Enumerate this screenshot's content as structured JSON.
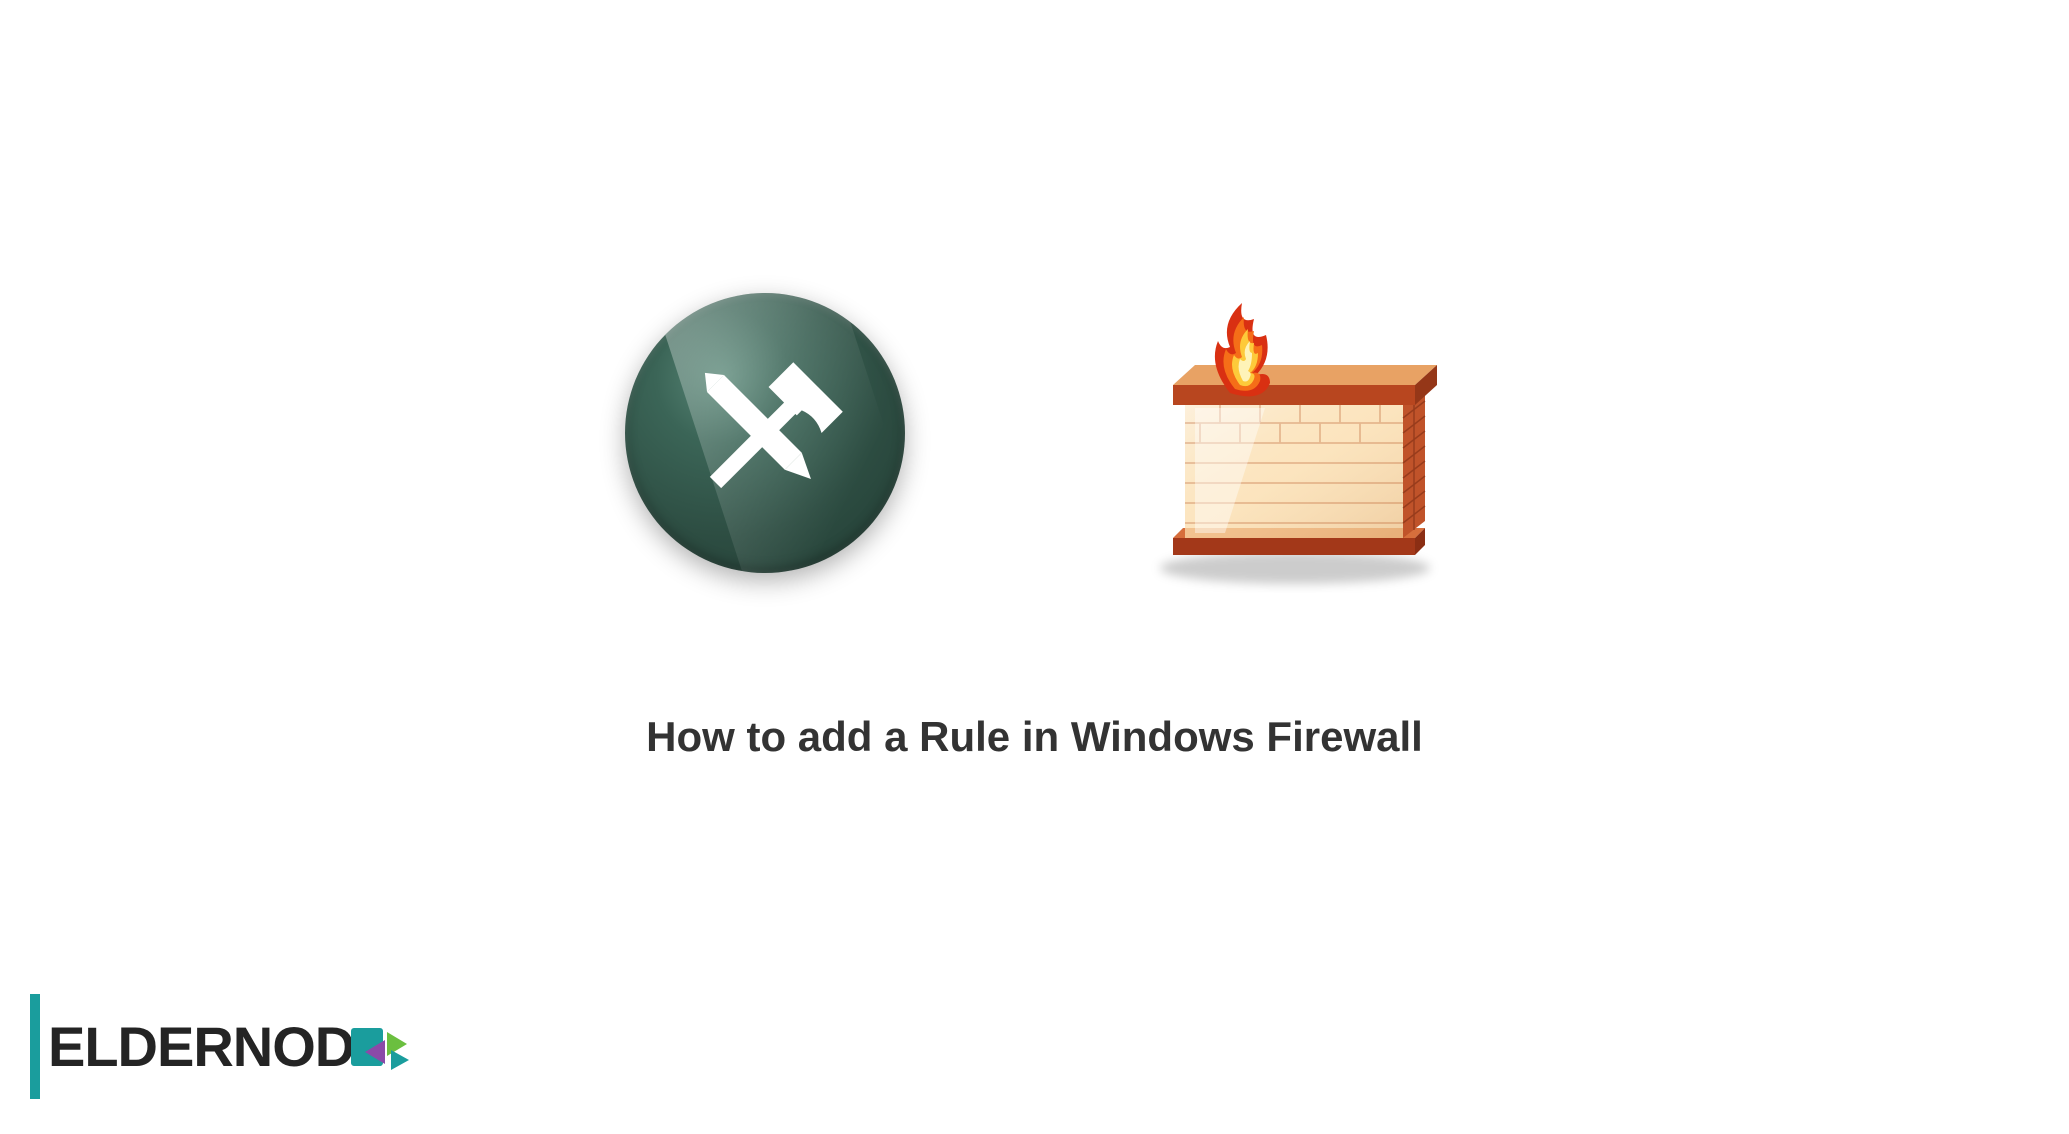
{
  "title": "How to add a Rule in Windows Firewall",
  "logo": {
    "text": "ELDERNOD",
    "accent_color": "#1a9d9d"
  },
  "icons": {
    "tools": "tools-hammer-pencil-icon",
    "firewall": "windows-firewall-icon"
  }
}
